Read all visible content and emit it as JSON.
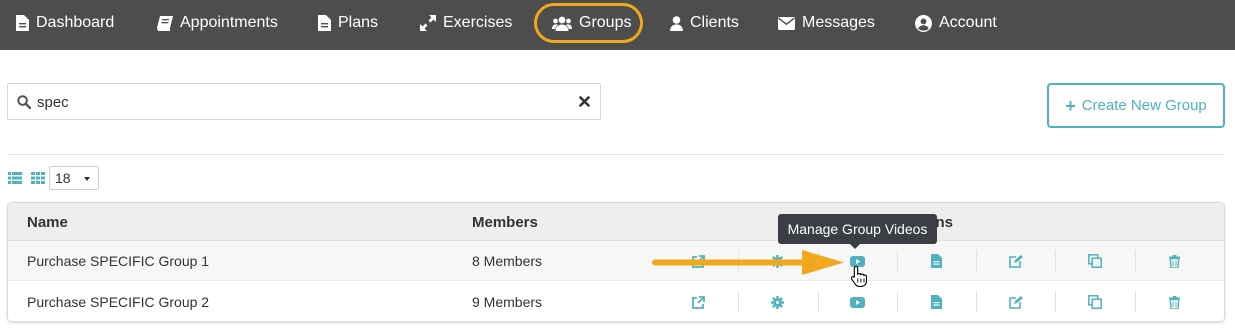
{
  "nav": {
    "items": [
      {
        "label": "Dashboard",
        "icon": "file-icon"
      },
      {
        "label": "Appointments",
        "icon": "book-icon"
      },
      {
        "label": "Plans",
        "icon": "file-icon"
      },
      {
        "label": "Exercises",
        "icon": "expand-icon"
      },
      {
        "label": "Groups",
        "icon": "users-icon",
        "active": true
      },
      {
        "label": "Clients",
        "icon": "user-icon"
      },
      {
        "label": "Messages",
        "icon": "envelope-icon"
      },
      {
        "label": "Account",
        "icon": "user-circle-icon"
      }
    ]
  },
  "search": {
    "value": "spec"
  },
  "create_button": {
    "label": "Create New Group"
  },
  "page_size": {
    "value": "18"
  },
  "table": {
    "headers": {
      "name": "Name",
      "members": "Members",
      "actions": "Actions"
    },
    "rows": [
      {
        "name": "Purchase SPECIFIC Group 1",
        "members": "8 Members"
      },
      {
        "name": "Purchase SPECIFIC Group 2",
        "members": "9 Members"
      }
    ]
  },
  "tooltip": {
    "text": "Manage Group Videos"
  },
  "colors": {
    "nav_bg": "#4d4d4d",
    "accent": "#4fb3bf",
    "highlight": "#f2a81d",
    "tooltip_bg": "#3b3f45"
  }
}
